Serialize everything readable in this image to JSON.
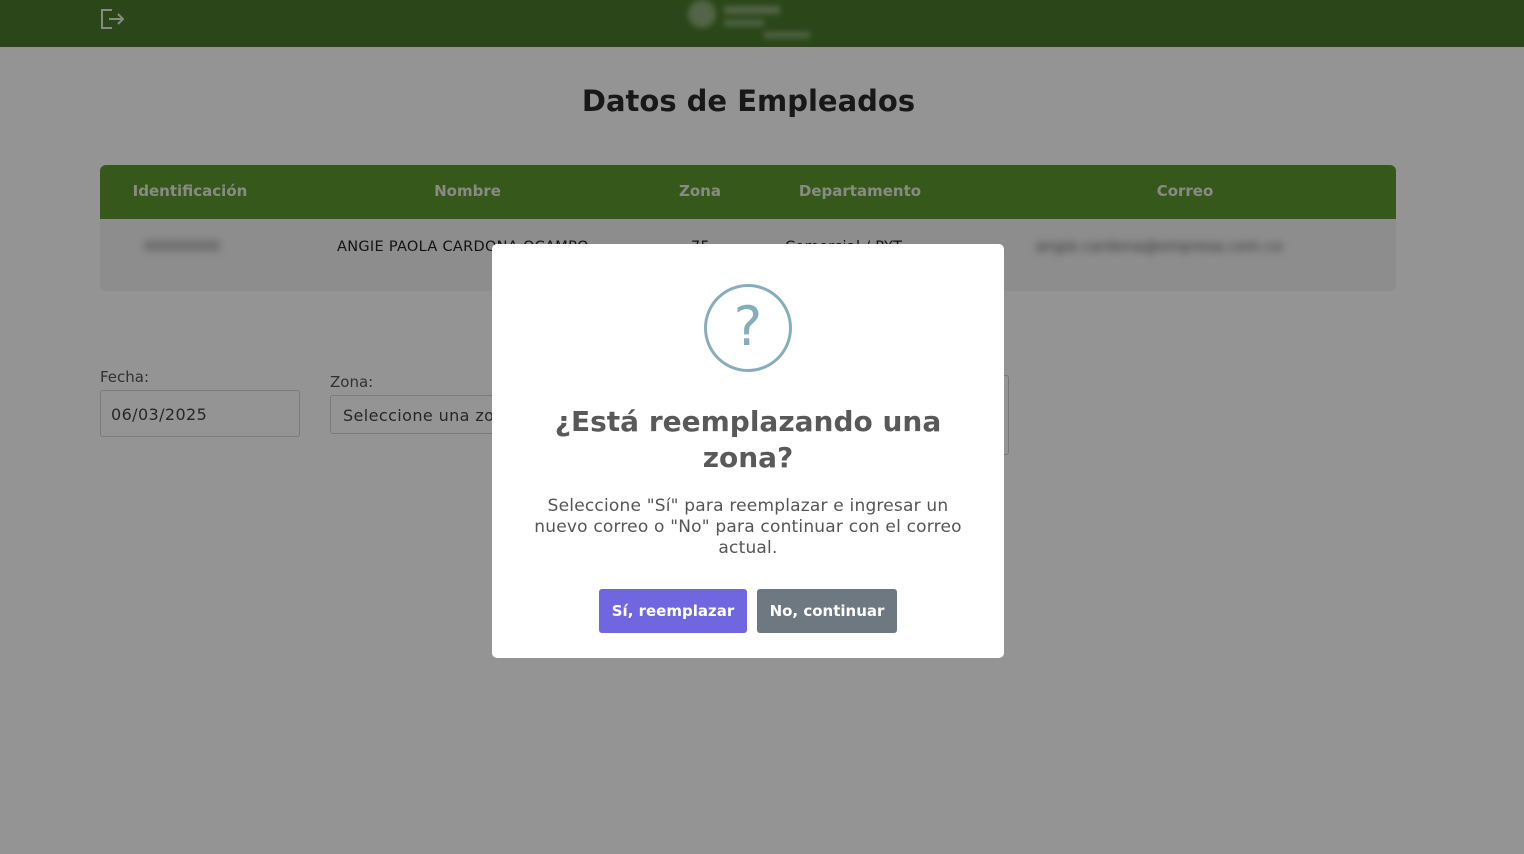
{
  "header": {
    "logout_icon": "logout-icon",
    "logo_icon": "company-logo"
  },
  "page": {
    "title": "Datos de Empleados"
  },
  "table": {
    "headers": [
      "Identificación",
      "Nombre",
      "Zona",
      "Departamento",
      "Correo"
    ],
    "rows": [
      {
        "identificacion": "00000000",
        "nombre": "ANGIE PAOLA CARDONA OCAMPO",
        "zona": "75",
        "departamento": "Comercial / PYT",
        "correo": "angie.cardona@empresa.com.co"
      }
    ]
  },
  "form": {
    "fecha_label": "Fecha:",
    "fecha_value": "06/03/2025",
    "zona_label": "Zona:",
    "zona_placeholder": "Seleccione una zona"
  },
  "modal": {
    "icon": "question-icon",
    "icon_glyph": "?",
    "title": "¿Está reemplazando una zona?",
    "text": "Seleccione \"Sí\" para reemplazar e ingresar un nuevo correo o \"No\" para continuar con el correo actual.",
    "confirm_label": "Sí, reemplazar",
    "cancel_label": "No, continuar",
    "confirm_color": "#7066e0",
    "cancel_color": "#6e7881"
  },
  "colors": {
    "header_bg": "#4b7a2b",
    "table_header_bg": "#5e9830",
    "icon_color": "#87adbd"
  }
}
